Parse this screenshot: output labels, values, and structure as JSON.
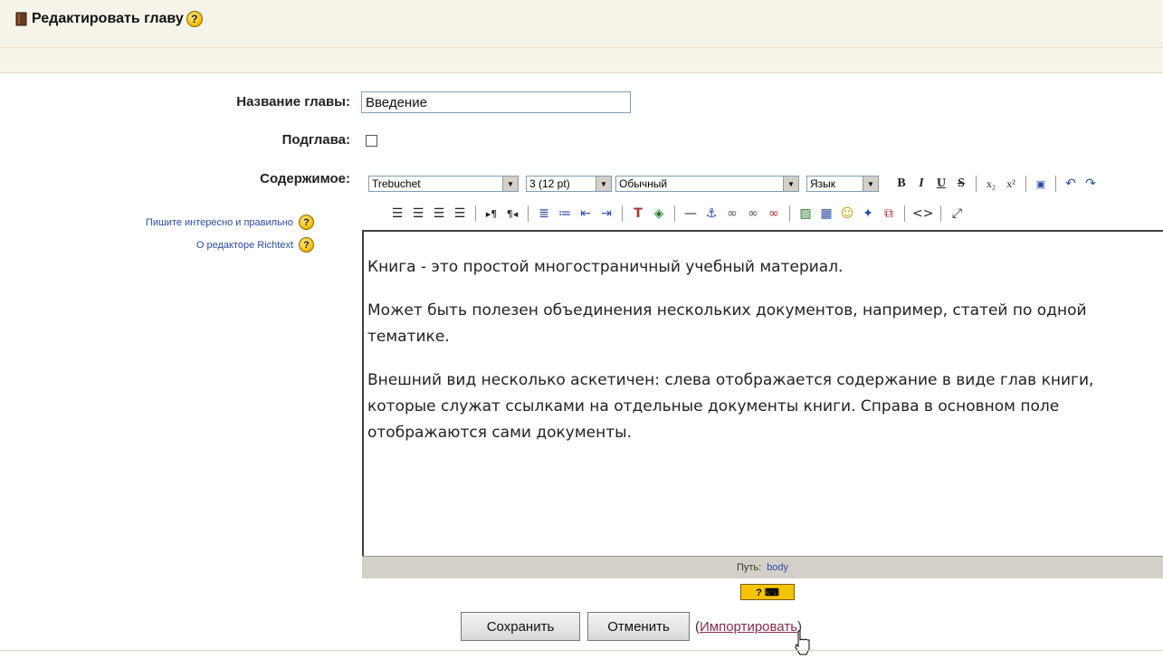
{
  "header": {
    "title": "Редактировать главу",
    "help": "?"
  },
  "form": {
    "chapter_title_label": "Название главы:",
    "chapter_title_value": "Введение",
    "subchapter_label": "Подглава:",
    "subchapter_checked": false,
    "content_label": "Содержимое:"
  },
  "side_links": [
    {
      "label": "Пишите интересно и правильно",
      "help": "?"
    },
    {
      "label": "О редакторе Richtext",
      "help": "?"
    }
  ],
  "toolbar": {
    "font_family": "Trebuchet",
    "font_size": "3 (12 pt)",
    "paragraph_style": "Обычный",
    "language": "Язык",
    "row1_buttons": [
      "bold-icon",
      "italic-icon",
      "underline-icon",
      "strikethrough-icon",
      "subscript-icon",
      "superscript-icon",
      "clean-word-icon",
      "undo-icon",
      "redo-icon"
    ],
    "row2_buttons": [
      "align-left-icon",
      "align-center-icon",
      "align-right-icon",
      "align-justify-icon",
      "ltr-icon",
      "rtl-icon",
      "ordered-list-icon",
      "unordered-list-icon",
      "outdent-icon",
      "indent-icon",
      "text-color-icon",
      "background-color-icon",
      "horizontal-rule-icon",
      "anchor-icon",
      "link-icon",
      "unlink-icon",
      "nolink-icon",
      "image-icon",
      "table-icon",
      "smiley-icon",
      "special-char-icon",
      "search-replace-icon",
      "html-source-icon",
      "fullscreen-icon"
    ]
  },
  "editor": {
    "paragraphs": [
      "Книга - это простой многостраничный учебный материал.",
      "Может быть полезен объединения нескольких документов, например, статей по одной тематике.",
      "Внешний вид несколько аскетичен: слева отображается содержание в виде глав книги, которые служат ссылками на отдельные документы книги. Справа в основном поле отображаются сами документы."
    ],
    "path_label": "Путь:",
    "path_value": "body"
  },
  "actions": {
    "save": "Сохранить",
    "cancel": "Отменить",
    "import_open": "(",
    "import": "Импортировать",
    "import_close": ")"
  },
  "colors": {
    "header_bg": "#f6f3e8",
    "link": "#2a4aa8",
    "import_link": "#8a2a4a",
    "help_icon": "#f5b800"
  }
}
